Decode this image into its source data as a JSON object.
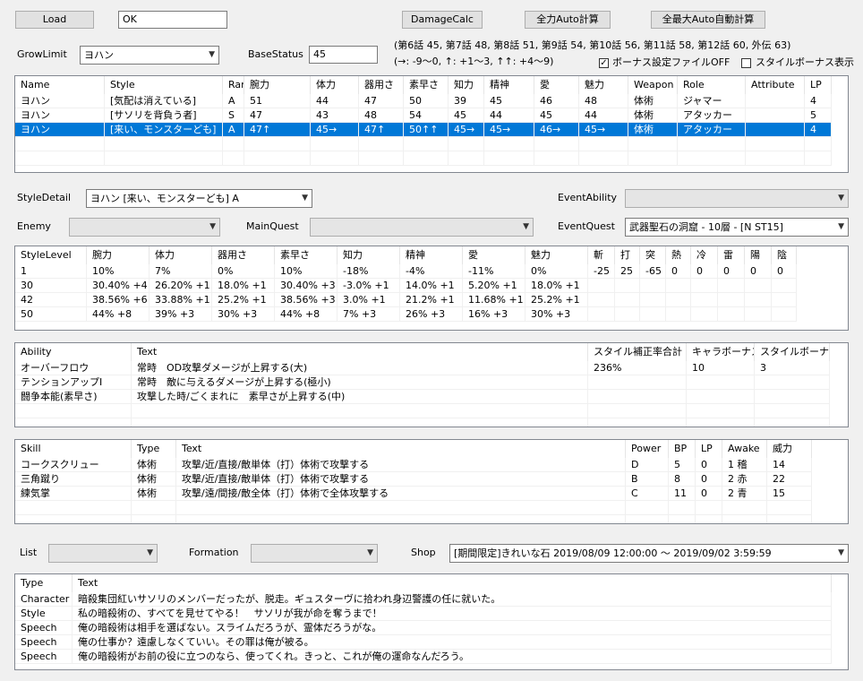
{
  "toolbar": {
    "load_label": "Load",
    "input_value": "OK",
    "damagecalc_label": "DamageCalc",
    "auto_calc_label": "全力Auto計算",
    "max_auto_calc_label": "全最大Auto自動計算"
  },
  "grow": {
    "growlimit_label": "GrowLimit",
    "growlimit_value": "ヨハン",
    "basestatus_label": "BaseStatus",
    "basestatus_value": "45",
    "episode_info": "(第6話 45, 第7話 48, 第8話 51, 第9話 54, 第10話 56, 第11話 58, 第12話 60, 外伝 63)",
    "arrow_info": "(→: -9～0, ↑: +1～3, ↑↑: +4～9)",
    "bonus_off_label": "ボーナス設定ファイルOFF",
    "bonus_off_checked": "✓",
    "style_bonus_label": "スタイルボーナス表示"
  },
  "styles": {
    "columns": [
      "Name",
      "Style",
      "Rarity",
      "腕力",
      "体力",
      "器用さ",
      "素早さ",
      "知力",
      "精神",
      "愛",
      "魅力",
      "Weapon",
      "Role",
      "Attribute",
      "LP"
    ],
    "rows": [
      [
        "ヨハン",
        "[気配は消えている]",
        "A",
        "51",
        "44",
        "47",
        "50",
        "39",
        "45",
        "46",
        "48",
        "体術",
        "ジャマー",
        "",
        "4"
      ],
      [
        "ヨハン",
        "[サソリを背負う者]",
        "S",
        "47",
        "43",
        "48",
        "54",
        "45",
        "44",
        "45",
        "44",
        "体術",
        "アタッカー",
        "",
        "5"
      ],
      [
        "ヨハン",
        "[来い、モンスターども]",
        "A",
        "47↑",
        "45→",
        "47↑",
        "50↑↑",
        "45→",
        "45→",
        "46→",
        "45→",
        "体術",
        "アタッカー",
        "",
        "4"
      ]
    ],
    "selected_row": 2
  },
  "filters": {
    "styledetail_label": "StyleDetail",
    "styledetail_value": "ヨハン [来い、モンスターども] A",
    "eventability_label": "EventAbility",
    "eventability_value": "",
    "enemy_label": "Enemy",
    "enemy_value": "",
    "mainquest_label": "MainQuest",
    "mainquest_value": "",
    "eventquest_label": "EventQuest",
    "eventquest_value": "武器聖石の洞窟 - 10層 - [N ST15]"
  },
  "levels": {
    "columns": [
      "StyleLevel",
      "腕力",
      "体力",
      "器用さ",
      "素早さ",
      "知力",
      "精神",
      "愛",
      "魅力",
      "斬",
      "打",
      "突",
      "熱",
      "冷",
      "雷",
      "陽",
      "陰"
    ],
    "rows": [
      [
        "1",
        "10%",
        "7%",
        "0%",
        "10%",
        "-18%",
        "-4%",
        "-11%",
        "0%",
        "-25",
        "25",
        "-65",
        "0",
        "0",
        "0",
        "0",
        "0"
      ],
      [
        "30",
        "30.40% +4",
        "26.20% +1",
        "18.0% +1",
        "30.40% +3",
        "-3.0% +1",
        "14.0% +1",
        "5.20% +1",
        "18.0% +1",
        "",
        "",
        "",
        "",
        "",
        "",
        "",
        ""
      ],
      [
        "42",
        "38.56% +6",
        "33.88% +1",
        "25.2% +1",
        "38.56% +3",
        "3.0% +1",
        "21.2% +1",
        "11.68% +1",
        "25.2% +1",
        "",
        "",
        "",
        "",
        "",
        "",
        "",
        ""
      ],
      [
        "50",
        "44% +8",
        "39% +3",
        "30% +3",
        "44% +8",
        "7% +3",
        "26% +3",
        "16% +3",
        "30% +3",
        "",
        "",
        "",
        "",
        "",
        "",
        "",
        ""
      ]
    ]
  },
  "abilities": {
    "columns": [
      "Ability",
      "Text",
      "スタイル補正率合計",
      "キャラボーナス",
      "スタイルボーナス"
    ],
    "rows": [
      [
        "オーバーフロウ",
        "常時　OD攻撃ダメージが上昇する(大)",
        "236%",
        "10",
        "3"
      ],
      [
        "テンションアップⅠ",
        "常時　敵に与えるダメージが上昇する(極小)",
        "",
        "",
        ""
      ],
      [
        "闘争本能(素早さ)",
        "攻撃した時/ごくまれに　素早さが上昇する(中)",
        "",
        "",
        ""
      ]
    ]
  },
  "skills": {
    "columns": [
      "Skill",
      "Type",
      "Text",
      "Power",
      "BP",
      "LP",
      "Awake",
      "威力"
    ],
    "rows": [
      [
        "コークスクリュー",
        "体術",
        "攻撃/近/直接/敵単体（打）体術で攻撃する",
        "D",
        "5",
        "0",
        "1 稽",
        "14"
      ],
      [
        "三角蹴り",
        "体術",
        "攻撃/近/直接/敵単体（打）体術で攻撃する",
        "B",
        "8",
        "0",
        "2 赤",
        "22"
      ],
      [
        "練気掌",
        "体術",
        "攻撃/遠/間接/敵全体（打）体術で全体攻撃する",
        "C",
        "11",
        "0",
        "2 青",
        "15"
      ]
    ]
  },
  "bottom": {
    "list_label": "List",
    "list_value": "",
    "formation_label": "Formation",
    "formation_value": "",
    "shop_label": "Shop",
    "shop_value": "[期間限定]きれいな石 2019/08/09 12:00:00 ～ 2019/09/02 3:59:59"
  },
  "texts": {
    "columns": [
      "Type",
      "Text"
    ],
    "rows": [
      [
        "Character",
        "暗殺集団紅いサソリのメンバーだったが、脱走。ギュスターヴに拾われ身辺警護の任に就いた。"
      ],
      [
        "Style",
        "私の暗殺術の、すべてを見せてやる！　サソリが我が命を奪うまで！"
      ],
      [
        "Speech",
        "俺の暗殺術は相手を選ばない。スライムだろうが、霊体だろうがな。"
      ],
      [
        "Speech",
        "俺の仕事か？遠慮しなくていい。その罪は俺が被る。"
      ],
      [
        "Speech",
        "俺の暗殺術がお前の役に立つのなら、使ってくれ。きっと、これが俺の運命なんだろう。"
      ]
    ]
  }
}
